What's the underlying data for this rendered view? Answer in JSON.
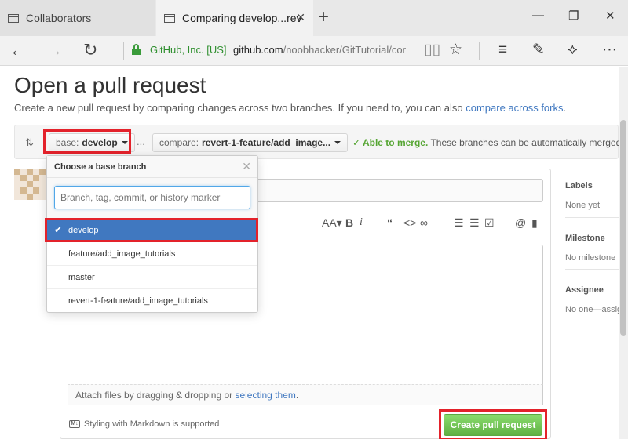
{
  "browser": {
    "tabs": [
      {
        "label": "Collaborators"
      },
      {
        "label": "Comparing develop...rev"
      }
    ],
    "site_identity": "GitHub, Inc. [US]",
    "url_host": "github.com",
    "url_path": "/noobhacker/GitTutorial/cor"
  },
  "page": {
    "title": "Open a pull request",
    "subtitle": "Create a new pull request by comparing changes across two branches. If you need to, you can also",
    "subtitle_link": "compare across forks",
    "subtitle_end": ".",
    "base": {
      "label": "base:",
      "value": "develop"
    },
    "compare": {
      "label": "compare:",
      "value": "revert-1-feature/add_image..."
    },
    "ellipsis": "...",
    "merge_status": "Able to merge.",
    "merge_detail": "These branches can be automatically merged.",
    "attach_text": "Attach files by dragging & dropping or",
    "attach_link": "selecting them",
    "attach_end": ".",
    "markdown_badge": "M↓",
    "markdown_note": "Styling with Markdown is supported",
    "create_button": "Create pull request"
  },
  "sidebar": {
    "labels": {
      "heading": "Labels",
      "value": "None yet"
    },
    "milestone": {
      "heading": "Milestone",
      "value": "No milestone"
    },
    "assignee": {
      "heading": "Assignee",
      "value": "No one—assign yourself"
    }
  },
  "dropdown": {
    "title": "Choose a base branch",
    "filter_placeholder": "Branch, tag, commit, or history marker",
    "branches": [
      {
        "name": "develop",
        "selected": true
      },
      {
        "name": "feature/add_image_tutorials",
        "selected": false
      },
      {
        "name": "master",
        "selected": false
      },
      {
        "name": "revert-1-feature/add_image_tutorials",
        "selected": false
      }
    ]
  },
  "colors": {
    "link": "#4078c0",
    "merge_ok": "#55a532",
    "highlight": "#e3222b",
    "create_button": "#60b044",
    "selected_branch": "#4078c0"
  }
}
